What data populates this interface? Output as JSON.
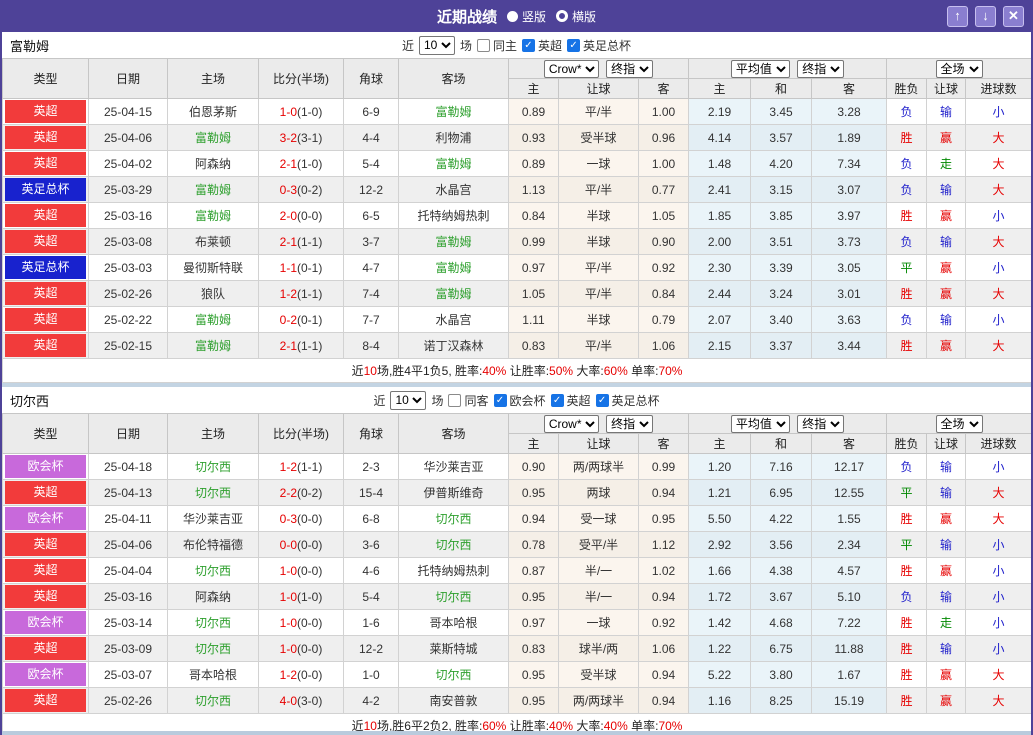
{
  "titlebar": {
    "title": "近期战绩",
    "vertical_label": "竖版",
    "horizontal_label": "横版",
    "icons": {
      "up": "↑",
      "down": "↓",
      "close": "✕"
    }
  },
  "selects": {
    "crow": "Crow*",
    "final": "终指",
    "avg": "平均值",
    "full": "全场",
    "recent": "10"
  },
  "columns": {
    "type": "类型",
    "date": "日期",
    "home": "主场",
    "score": "比分(半场)",
    "corners": "角球",
    "away": "客场",
    "crow_home": "主",
    "crow_handicap": "让球",
    "crow_away": "客",
    "avg_home": "主",
    "avg_draw": "和",
    "avg_away": "客",
    "result_wdl": "胜负",
    "result_handicap": "让球",
    "result_goals": "进球数"
  },
  "colors": {
    "accent_purple": "#4e4298",
    "epl_red": "#f23b3b",
    "facup_blue": "#1822ce",
    "uecl_purple": "#c869db",
    "team_green": "#2ea02e",
    "win_red": "#e60000",
    "lose_blue": "#2222cc",
    "draw_green": "#008800"
  },
  "sections": [
    {
      "team": "富勒姆",
      "controls": {
        "recent_label": "近",
        "recent_value": "10",
        "games_label": "场",
        "same_label": "同主",
        "same_checked": false,
        "leagues": [
          {
            "label": "英超",
            "checked": true
          },
          {
            "label": "英足总杯",
            "checked": true
          }
        ]
      },
      "rows": [
        {
          "league": "英超",
          "league_key": "epl",
          "date": "25-04-15",
          "home": "伯恩茅斯",
          "home_focus": false,
          "score_ft": "1-0",
          "score_ht": "(1-0)",
          "corners": "6-9",
          "away": "富勒姆",
          "away_focus": true,
          "crow": [
            "0.89",
            "平/半",
            "1.00"
          ],
          "avg": [
            "2.19",
            "3.45",
            "3.28"
          ],
          "results": [
            {
              "text": "负",
              "key": "lose"
            },
            {
              "text": "输",
              "key": "lose"
            },
            {
              "text": "小",
              "key": "lose"
            }
          ]
        },
        {
          "league": "英超",
          "league_key": "epl",
          "date": "25-04-06",
          "home": "富勒姆",
          "home_focus": true,
          "score_ft": "3-2",
          "score_ht": "(3-1)",
          "corners": "4-4",
          "away": "利物浦",
          "away_focus": false,
          "crow": [
            "0.93",
            "受半球",
            "0.96"
          ],
          "avg": [
            "4.14",
            "3.57",
            "1.89"
          ],
          "results": [
            {
              "text": "胜",
              "key": "win"
            },
            {
              "text": "赢",
              "key": "win"
            },
            {
              "text": "大",
              "key": "win"
            }
          ]
        },
        {
          "league": "英超",
          "league_key": "epl",
          "date": "25-04-02",
          "home": "阿森纳",
          "home_focus": false,
          "score_ft": "2-1",
          "score_ht": "(1-0)",
          "corners": "5-4",
          "away": "富勒姆",
          "away_focus": true,
          "crow": [
            "0.89",
            "一球",
            "1.00"
          ],
          "avg": [
            "1.48",
            "4.20",
            "7.34"
          ],
          "results": [
            {
              "text": "负",
              "key": "lose"
            },
            {
              "text": "走",
              "key": "draw"
            },
            {
              "text": "大",
              "key": "win"
            }
          ]
        },
        {
          "league": "英足总杯",
          "league_key": "facup",
          "date": "25-03-29",
          "home": "富勒姆",
          "home_focus": true,
          "score_ft": "0-3",
          "score_ht": "(0-2)",
          "corners": "12-2",
          "away": "水晶宫",
          "away_focus": false,
          "crow": [
            "1.13",
            "平/半",
            "0.77"
          ],
          "avg": [
            "2.41",
            "3.15",
            "3.07"
          ],
          "results": [
            {
              "text": "负",
              "key": "lose"
            },
            {
              "text": "输",
              "key": "lose"
            },
            {
              "text": "大",
              "key": "win"
            }
          ]
        },
        {
          "league": "英超",
          "league_key": "epl",
          "date": "25-03-16",
          "home": "富勒姆",
          "home_focus": true,
          "score_ft": "2-0",
          "score_ht": "(0-0)",
          "corners": "6-5",
          "away": "托特纳姆热刺",
          "away_focus": false,
          "crow": [
            "0.84",
            "半球",
            "1.05"
          ],
          "avg": [
            "1.85",
            "3.85",
            "3.97"
          ],
          "results": [
            {
              "text": "胜",
              "key": "win"
            },
            {
              "text": "赢",
              "key": "win"
            },
            {
              "text": "小",
              "key": "lose"
            }
          ]
        },
        {
          "league": "英超",
          "league_key": "epl",
          "date": "25-03-08",
          "home": "布莱顿",
          "home_focus": false,
          "score_ft": "2-1",
          "score_ht": "(1-1)",
          "corners": "3-7",
          "away": "富勒姆",
          "away_focus": true,
          "crow": [
            "0.99",
            "半球",
            "0.90"
          ],
          "avg": [
            "2.00",
            "3.51",
            "3.73"
          ],
          "results": [
            {
              "text": "负",
              "key": "lose"
            },
            {
              "text": "输",
              "key": "lose"
            },
            {
              "text": "大",
              "key": "win"
            }
          ]
        },
        {
          "league": "英足总杯",
          "league_key": "facup",
          "date": "25-03-03",
          "home": "曼彻斯特联",
          "home_focus": false,
          "score_ft": "1-1",
          "score_ht": "(0-1)",
          "corners": "4-7",
          "away": "富勒姆",
          "away_focus": true,
          "crow": [
            "0.97",
            "平/半",
            "0.92"
          ],
          "avg": [
            "2.30",
            "3.39",
            "3.05"
          ],
          "results": [
            {
              "text": "平",
              "key": "draw"
            },
            {
              "text": "赢",
              "key": "win"
            },
            {
              "text": "小",
              "key": "lose"
            }
          ]
        },
        {
          "league": "英超",
          "league_key": "epl",
          "date": "25-02-26",
          "home": "狼队",
          "home_focus": false,
          "score_ft": "1-2",
          "score_ht": "(1-1)",
          "corners": "7-4",
          "away": "富勒姆",
          "away_focus": true,
          "crow": [
            "1.05",
            "平/半",
            "0.84"
          ],
          "avg": [
            "2.44",
            "3.24",
            "3.01"
          ],
          "results": [
            {
              "text": "胜",
              "key": "win"
            },
            {
              "text": "赢",
              "key": "win"
            },
            {
              "text": "大",
              "key": "win"
            }
          ]
        },
        {
          "league": "英超",
          "league_key": "epl",
          "date": "25-02-22",
          "home": "富勒姆",
          "home_focus": true,
          "score_ft": "0-2",
          "score_ht": "(0-1)",
          "corners": "7-7",
          "away": "水晶宫",
          "away_focus": false,
          "crow": [
            "1.11",
            "半球",
            "0.79"
          ],
          "avg": [
            "2.07",
            "3.40",
            "3.63"
          ],
          "results": [
            {
              "text": "负",
              "key": "lose"
            },
            {
              "text": "输",
              "key": "lose"
            },
            {
              "text": "小",
              "key": "lose"
            }
          ]
        },
        {
          "league": "英超",
          "league_key": "epl",
          "date": "25-02-15",
          "home": "富勒姆",
          "home_focus": true,
          "score_ft": "2-1",
          "score_ht": "(1-1)",
          "corners": "8-4",
          "away": "诺丁汉森林",
          "away_focus": false,
          "crow": [
            "0.83",
            "平/半",
            "1.06"
          ],
          "avg": [
            "2.15",
            "3.37",
            "3.44"
          ],
          "results": [
            {
              "text": "胜",
              "key": "win"
            },
            {
              "text": "赢",
              "key": "win"
            },
            {
              "text": "大",
              "key": "win"
            }
          ]
        }
      ],
      "summary": [
        {
          "text": "近"
        },
        {
          "text": "10",
          "red": true
        },
        {
          "text": "场,胜4平1负5, 胜率:"
        },
        {
          "text": "40%",
          "red": true
        },
        {
          "text": " 让胜率:"
        },
        {
          "text": "50%",
          "red": true
        },
        {
          "text": " 大率:"
        },
        {
          "text": "60%",
          "red": true
        },
        {
          "text": " 单率:"
        },
        {
          "text": "70%",
          "red": true
        }
      ]
    },
    {
      "team": "切尔西",
      "controls": {
        "recent_label": "近",
        "recent_value": "10",
        "games_label": "场",
        "same_label": "同客",
        "same_checked": false,
        "leagues": [
          {
            "label": "欧会杯",
            "checked": true
          },
          {
            "label": "英超",
            "checked": true
          },
          {
            "label": "英足总杯",
            "checked": true
          }
        ]
      },
      "rows": [
        {
          "league": "欧会杯",
          "league_key": "uecl",
          "date": "25-04-18",
          "home": "切尔西",
          "home_focus": true,
          "score_ft": "1-2",
          "score_ht": "(1-1)",
          "corners": "2-3",
          "away": "华沙莱吉亚",
          "away_focus": false,
          "crow": [
            "0.90",
            "两/两球半",
            "0.99"
          ],
          "avg": [
            "1.20",
            "7.16",
            "12.17"
          ],
          "results": [
            {
              "text": "负",
              "key": "lose"
            },
            {
              "text": "输",
              "key": "lose"
            },
            {
              "text": "小",
              "key": "lose"
            }
          ]
        },
        {
          "league": "英超",
          "league_key": "epl",
          "date": "25-04-13",
          "home": "切尔西",
          "home_focus": true,
          "score_ft": "2-2",
          "score_ht": "(0-2)",
          "corners": "15-4",
          "away": "伊普斯维奇",
          "away_focus": false,
          "crow": [
            "0.95",
            "两球",
            "0.94"
          ],
          "avg": [
            "1.21",
            "6.95",
            "12.55"
          ],
          "results": [
            {
              "text": "平",
              "key": "draw"
            },
            {
              "text": "输",
              "key": "lose"
            },
            {
              "text": "大",
              "key": "win"
            }
          ]
        },
        {
          "league": "欧会杯",
          "league_key": "uecl",
          "date": "25-04-11",
          "home": "华沙莱吉亚",
          "home_focus": false,
          "score_ft": "0-3",
          "score_ht": "(0-0)",
          "corners": "6-8",
          "away": "切尔西",
          "away_focus": true,
          "crow": [
            "0.94",
            "受一球",
            "0.95"
          ],
          "avg": [
            "5.50",
            "4.22",
            "1.55"
          ],
          "results": [
            {
              "text": "胜",
              "key": "win"
            },
            {
              "text": "赢",
              "key": "win"
            },
            {
              "text": "大",
              "key": "win"
            }
          ]
        },
        {
          "league": "英超",
          "league_key": "epl",
          "date": "25-04-06",
          "home": "布伦特福德",
          "home_focus": false,
          "score_ft": "0-0",
          "score_ht": "(0-0)",
          "corners": "3-6",
          "away": "切尔西",
          "away_focus": true,
          "crow": [
            "0.78",
            "受平/半",
            "1.12"
          ],
          "avg": [
            "2.92",
            "3.56",
            "2.34"
          ],
          "results": [
            {
              "text": "平",
              "key": "draw"
            },
            {
              "text": "输",
              "key": "lose"
            },
            {
              "text": "小",
              "key": "lose"
            }
          ]
        },
        {
          "league": "英超",
          "league_key": "epl",
          "date": "25-04-04",
          "home": "切尔西",
          "home_focus": true,
          "score_ft": "1-0",
          "score_ht": "(0-0)",
          "corners": "4-6",
          "away": "托特纳姆热刺",
          "away_focus": false,
          "crow": [
            "0.87",
            "半/一",
            "1.02"
          ],
          "avg": [
            "1.66",
            "4.38",
            "4.57"
          ],
          "results": [
            {
              "text": "胜",
              "key": "win"
            },
            {
              "text": "赢",
              "key": "win"
            },
            {
              "text": "小",
              "key": "lose"
            }
          ]
        },
        {
          "league": "英超",
          "league_key": "epl",
          "date": "25-03-16",
          "home": "阿森纳",
          "home_focus": false,
          "score_ft": "1-0",
          "score_ht": "(1-0)",
          "corners": "5-4",
          "away": "切尔西",
          "away_focus": true,
          "crow": [
            "0.95",
            "半/一",
            "0.94"
          ],
          "avg": [
            "1.72",
            "3.67",
            "5.10"
          ],
          "results": [
            {
              "text": "负",
              "key": "lose"
            },
            {
              "text": "输",
              "key": "lose"
            },
            {
              "text": "小",
              "key": "lose"
            }
          ]
        },
        {
          "league": "欧会杯",
          "league_key": "uecl",
          "date": "25-03-14",
          "home": "切尔西",
          "home_focus": true,
          "score_ft": "1-0",
          "score_ht": "(0-0)",
          "corners": "1-6",
          "away": "哥本哈根",
          "away_focus": false,
          "crow": [
            "0.97",
            "一球",
            "0.92"
          ],
          "avg": [
            "1.42",
            "4.68",
            "7.22"
          ],
          "results": [
            {
              "text": "胜",
              "key": "win"
            },
            {
              "text": "走",
              "key": "draw"
            },
            {
              "text": "小",
              "key": "lose"
            }
          ]
        },
        {
          "league": "英超",
          "league_key": "epl",
          "date": "25-03-09",
          "home": "切尔西",
          "home_focus": true,
          "score_ft": "1-0",
          "score_ht": "(0-0)",
          "corners": "12-2",
          "away": "莱斯特城",
          "away_focus": false,
          "crow": [
            "0.83",
            "球半/两",
            "1.06"
          ],
          "avg": [
            "1.22",
            "6.75",
            "11.88"
          ],
          "results": [
            {
              "text": "胜",
              "key": "win"
            },
            {
              "text": "输",
              "key": "lose"
            },
            {
              "text": "小",
              "key": "lose"
            }
          ]
        },
        {
          "league": "欧会杯",
          "league_key": "uecl",
          "date": "25-03-07",
          "home": "哥本哈根",
          "home_focus": false,
          "score_ft": "1-2",
          "score_ht": "(0-0)",
          "corners": "1-0",
          "away": "切尔西",
          "away_focus": true,
          "crow": [
            "0.95",
            "受半球",
            "0.94"
          ],
          "avg": [
            "5.22",
            "3.80",
            "1.67"
          ],
          "results": [
            {
              "text": "胜",
              "key": "win"
            },
            {
              "text": "赢",
              "key": "win"
            },
            {
              "text": "大",
              "key": "win"
            }
          ]
        },
        {
          "league": "英超",
          "league_key": "epl",
          "date": "25-02-26",
          "home": "切尔西",
          "home_focus": true,
          "score_ft": "4-0",
          "score_ht": "(3-0)",
          "corners": "4-2",
          "away": "南安普敦",
          "away_focus": false,
          "crow": [
            "0.95",
            "两/两球半",
            "0.94"
          ],
          "avg": [
            "1.16",
            "8.25",
            "15.19"
          ],
          "results": [
            {
              "text": "胜",
              "key": "win"
            },
            {
              "text": "赢",
              "key": "win"
            },
            {
              "text": "大",
              "key": "win"
            }
          ]
        }
      ],
      "summary": [
        {
          "text": "近"
        },
        {
          "text": "10",
          "red": true
        },
        {
          "text": "场,胜6平2负2, 胜率:"
        },
        {
          "text": "60%",
          "red": true
        },
        {
          "text": " 让胜率:"
        },
        {
          "text": "40%",
          "red": true
        },
        {
          "text": " 大率:"
        },
        {
          "text": "40%",
          "red": true
        },
        {
          "text": " 单率:"
        },
        {
          "text": "70%",
          "red": true
        }
      ]
    }
  ]
}
